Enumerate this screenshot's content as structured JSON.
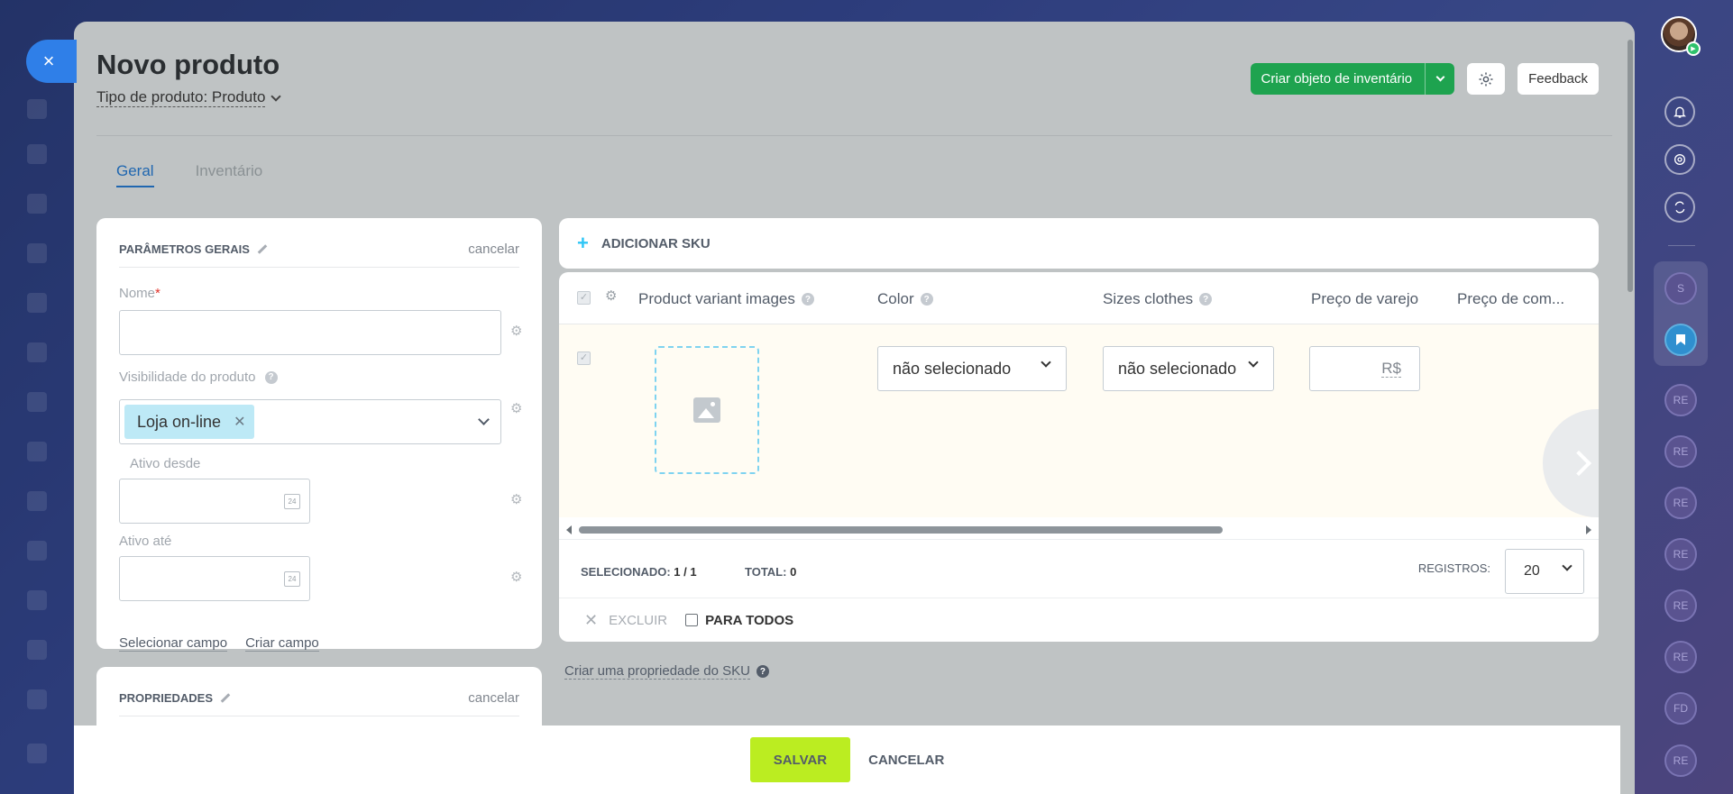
{
  "window": {
    "close_label": "×"
  },
  "header": {
    "title": "Novo produto",
    "product_type": "Tipo de produto: Produto",
    "create_inventory_label": "Criar objeto de inventário",
    "feedback_label": "Feedback"
  },
  "tabs": [
    {
      "label": "Geral",
      "active": true
    },
    {
      "label": "Inventário",
      "active": false
    }
  ],
  "general_params": {
    "title": "PARÂMETROS GERAIS",
    "cancel_label": "cancelar",
    "name_label": "Nome",
    "required_mark": "*",
    "name_value": "",
    "visibility_label": "Visibilidade do produto",
    "visibility_help": "?",
    "visibility_tag": "Loja on-line",
    "active_from_label": "Ativo desde",
    "active_to_label": "Ativo até",
    "calendar_day": "24",
    "select_field_link": "Selecionar campo",
    "create_field_link": "Criar campo"
  },
  "properties": {
    "title": "PROPRIEDADES",
    "cancel_label": "cancelar"
  },
  "sku": {
    "add_label": "ADICIONAR SKU",
    "columns": [
      {
        "label": "Product variant images",
        "help": true
      },
      {
        "label": "Color",
        "help": true
      },
      {
        "label": "Sizes clothes",
        "help": true
      },
      {
        "label": "Preço de varejo",
        "help": false
      },
      {
        "label": "Preço de com...",
        "help": false
      }
    ],
    "row": {
      "color_value": "não selecionado",
      "size_value": "não selecionado",
      "currency": "R$"
    },
    "selected_label": "SELECIONADO:",
    "selected_value": "1 / 1",
    "total_label": "TOTAL:",
    "total_value": "0",
    "records_label": "REGISTROS:",
    "records_value": "20",
    "delete_label": "EXCLUIR",
    "for_all_label": "PARA TODOS",
    "create_property_link": "Criar uma propriedade do SKU"
  },
  "footer": {
    "save_label": "SALVAR",
    "cancel_label": "CANCELAR"
  },
  "right_sidebar": {
    "items": [
      "S",
      "RE",
      "RE",
      "RE",
      "RE",
      "RE",
      "RE",
      "FD",
      "RE"
    ]
  },
  "colors": {
    "accent_blue": "#2067b0",
    "green_button": "#1ea34f",
    "save_button": "#bbed21",
    "close_button": "#2f7fe8"
  }
}
